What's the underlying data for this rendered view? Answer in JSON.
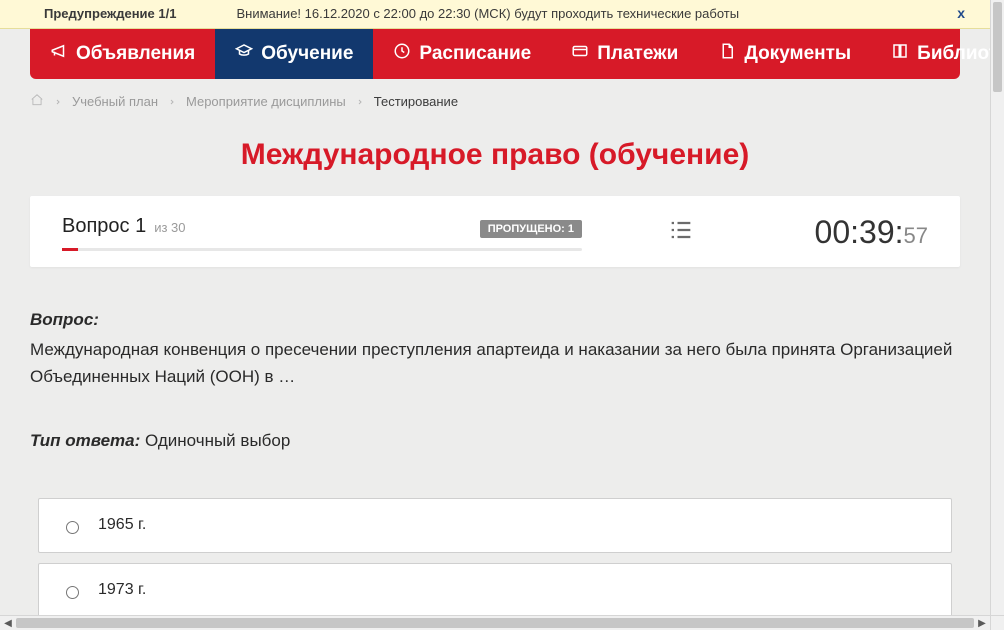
{
  "warning": {
    "title": "Предупреждение 1/1",
    "message": "Внимание! 16.12.2020 с 22:00 до 22:30 (МСК) будут проходить технические работы",
    "close": "x"
  },
  "nav": {
    "announcements": "Объявления",
    "learning": "Обучение",
    "schedule": "Расписание",
    "payments": "Платежи",
    "documents": "Документы",
    "library": "Библиотека"
  },
  "breadcrumbs": {
    "plan": "Учебный план",
    "event": "Мероприятие дисциплины",
    "current": "Тестирование"
  },
  "page_title": "Международное право (обучение)",
  "status": {
    "question_label": "Вопрос 1",
    "of_label": "из 30",
    "skipped_badge": "ПРОПУЩЕНО: 1",
    "timer_main": "00:39:",
    "timer_sec": "57"
  },
  "question": {
    "label": "Вопрос:",
    "text": "Международная конвенция о пресечении преступления апартеида и наказании за него была принята Организацией Объединенных Наций (ООН) в …",
    "answer_type_label": "Тип ответа:",
    "answer_type_value": " Одиночный выбор"
  },
  "options": [
    "1965 г.",
    "1973 г."
  ]
}
